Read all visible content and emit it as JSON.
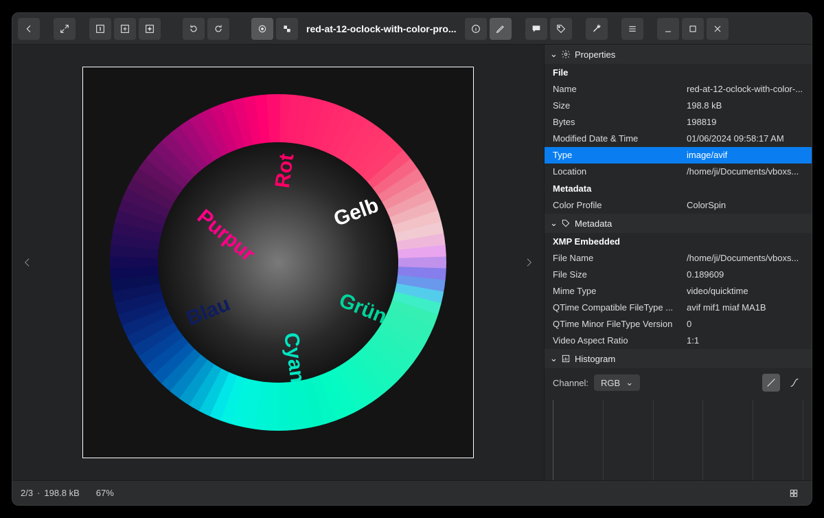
{
  "window": {
    "title": "red-at-12-oclock-with-color-pro..."
  },
  "image_labels": {
    "rot": "Rot",
    "gelb": "Gelb",
    "purpur": "Purpur",
    "gruen": "Grün",
    "blau": "Blau",
    "cyan": "Cyan"
  },
  "sidebar": {
    "properties": {
      "title": "Properties",
      "file_group": "File",
      "rows": {
        "name_k": "Name",
        "name_v": "red-at-12-oclock-with-color-...",
        "size_k": "Size",
        "size_v": "198.8 kB",
        "bytes_k": "Bytes",
        "bytes_v": "198819",
        "mod_k": "Modified Date & Time",
        "mod_v": "01/06/2024 09:58:17 AM",
        "type_k": "Type",
        "type_v": "image/avif",
        "loc_k": "Location",
        "loc_v": "/home/ji/Documents/vboxs..."
      },
      "meta_group": "Metadata",
      "meta_rows": {
        "cp_k": "Color Profile",
        "cp_v": "ColorSpin"
      }
    },
    "metadata": {
      "title": "Metadata",
      "xmp_group": "XMP Embedded",
      "rows": {
        "fn_k": "File Name",
        "fn_v": "/home/ji/Documents/vboxs...",
        "fs_k": "File Size",
        "fs_v": "0.189609",
        "mt_k": "Mime Type",
        "mt_v": "video/quicktime",
        "qc_k": "QTime Compatible FileType ...",
        "qc_v": "avif mif1 miaf MA1B",
        "qm_k": "QTime Minor FileType Version",
        "qm_v": "0",
        "ar_k": "Video Aspect Ratio",
        "ar_v": "1:1"
      }
    },
    "histogram": {
      "title": "Histogram",
      "channel_label": "Channel:",
      "channel_value": "RGB"
    }
  },
  "status": {
    "index": "2/3",
    "sep": "·",
    "size": "198.8 kB",
    "zoom": "67%"
  }
}
